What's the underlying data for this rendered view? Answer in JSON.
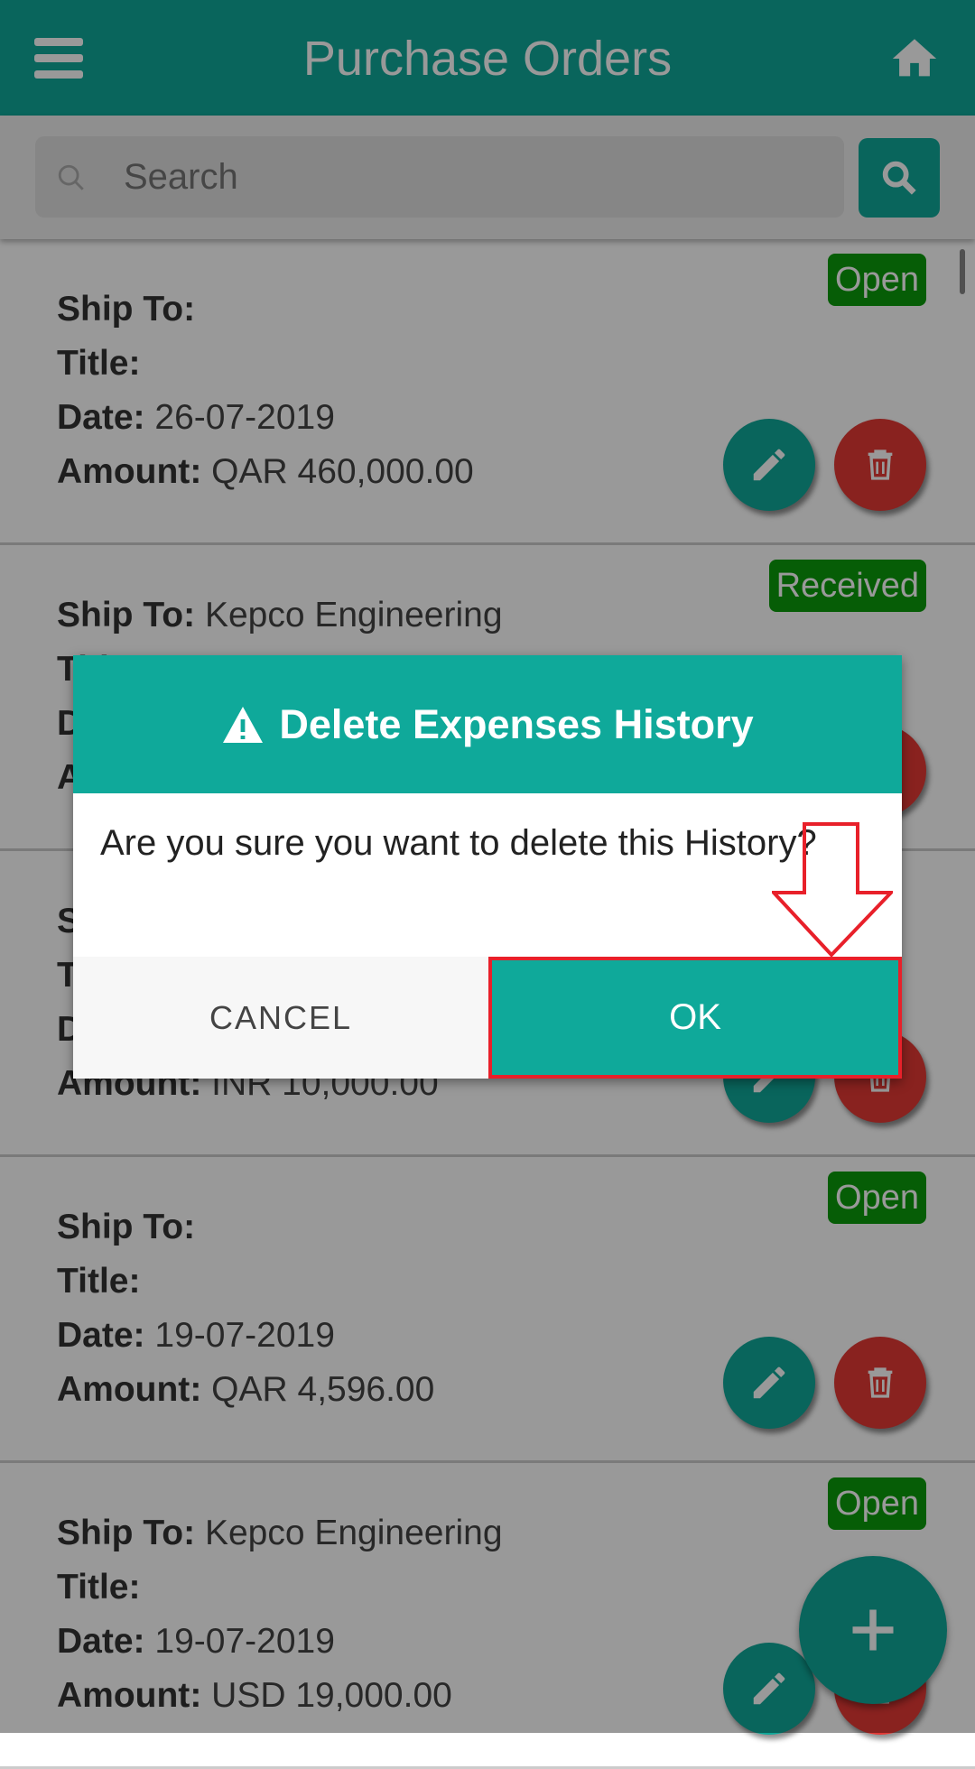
{
  "header": {
    "title": "Purchase Orders",
    "menu_icon": "hamburger-menu-icon",
    "home_icon": "home-icon"
  },
  "search": {
    "placeholder": "Search",
    "value": ""
  },
  "labels": {
    "ship_to": "Ship To",
    "title": "Title",
    "date": "Date",
    "amount": "Amount"
  },
  "orders": [
    {
      "status": "Open",
      "ship_to": "",
      "title": "",
      "date": "26-07-2019",
      "amount": "QAR 460,000.00"
    },
    {
      "status": "Received",
      "ship_to": "Kepco Engineering",
      "title": "",
      "date": "",
      "amount": ""
    },
    {
      "status": "",
      "ship_to": "",
      "title": "",
      "date": "",
      "amount": "INR 10,000.00"
    },
    {
      "status": "Open",
      "ship_to": "",
      "title": "",
      "date": "19-07-2019",
      "amount": "QAR 4,596.00"
    },
    {
      "status": "Open",
      "ship_to": "Kepco Engineering",
      "title": "",
      "date": "19-07-2019",
      "amount": "USD 19,000.00"
    }
  ],
  "dialog": {
    "title": "Delete Expenses History",
    "message": "Are you sure you want to delete this History?",
    "cancel": "CANCEL",
    "ok": "OK"
  },
  "colors": {
    "primary": "#0fa99a",
    "danger": "#e53935",
    "status_green": "#0a9c0a",
    "highlight": "#e8202a"
  }
}
